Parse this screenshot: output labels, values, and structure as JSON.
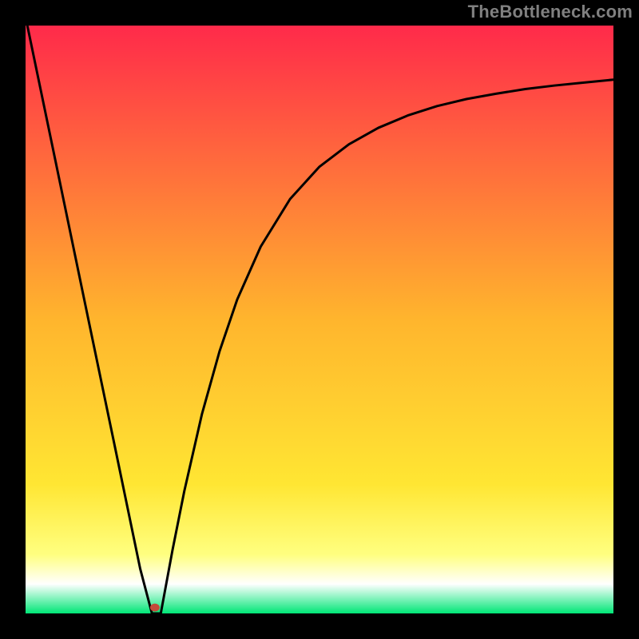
{
  "attribution": "TheBottleneck.com",
  "chart_data": {
    "type": "line",
    "title": "",
    "xlabel": "",
    "ylabel": "",
    "xlim": [
      0,
      100
    ],
    "ylim": [
      0,
      100
    ],
    "grid": false,
    "legend": false,
    "gradient_stops": [
      {
        "offset": 0.0,
        "color": "#ff2a4a"
      },
      {
        "offset": 0.5,
        "color": "#ffb52d"
      },
      {
        "offset": 0.78,
        "color": "#ffe633"
      },
      {
        "offset": 0.9,
        "color": "#ffff80"
      },
      {
        "offset": 0.95,
        "color": "#ffffff"
      },
      {
        "offset": 1.0,
        "color": "#00e676"
      }
    ],
    "series": [
      {
        "name": "bottleneck-curve",
        "color": "#000000",
        "x": [
          0.3,
          5,
          10,
          15,
          19.5,
          21.5,
          23,
          25,
          27,
          30,
          33,
          36,
          40,
          45,
          50,
          55,
          60,
          65,
          70,
          75,
          80,
          85,
          90,
          95,
          100
        ],
        "y": [
          100,
          77.4,
          53.3,
          29.3,
          7.6,
          0.0,
          0.0,
          10.8,
          20.8,
          33.9,
          44.6,
          53.4,
          62.4,
          70.5,
          76.0,
          79.8,
          82.6,
          84.7,
          86.3,
          87.5,
          88.4,
          89.2,
          89.8,
          90.3,
          90.8
        ]
      }
    ],
    "marker": {
      "x": 22.0,
      "y": 1.0,
      "color": "#c44a3a",
      "rx": 6,
      "ry": 5
    }
  }
}
